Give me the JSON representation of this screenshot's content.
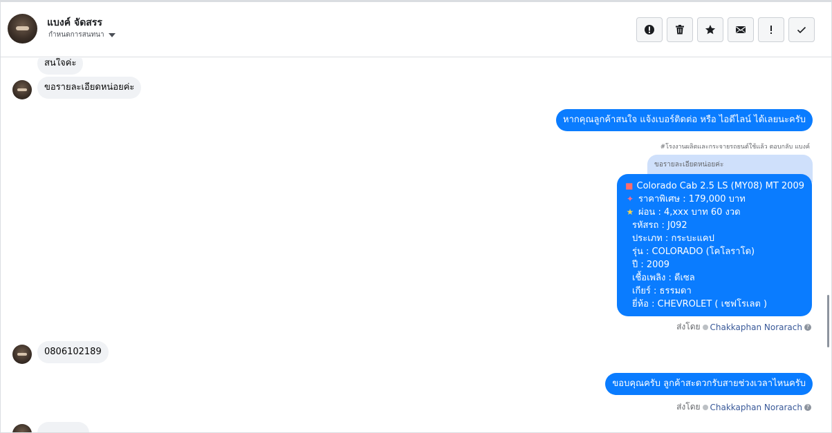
{
  "header": {
    "contact_name": "แบงค์ จัดสรร",
    "sub_label": "กำหนดการสนทนา"
  },
  "actions": [
    {
      "name": "report-button",
      "icon": "alert-circle-icon"
    },
    {
      "name": "delete-button",
      "icon": "trash-icon"
    },
    {
      "name": "star-button",
      "icon": "star-icon"
    },
    {
      "name": "mail-button",
      "icon": "mail-icon"
    },
    {
      "name": "important-button",
      "icon": "exclamation-icon"
    },
    {
      "name": "done-button",
      "icon": "check-icon"
    }
  ],
  "messages": {
    "in_1": "สนใจค่ะ",
    "in_2": "ขอรายละเอียดหน่อยค่ะ",
    "out_1": "หากคุณลูกค้าสนใจ แจ้งเบอร์ติดต่อ หรือ ไอดีไลน์ ได้เลยนะครับ",
    "reply_note": "#โรงงานผลิตและกระจายรถยนต์ใช้แล้ว ตอบกลับ แบงค์",
    "reply_quote": "ขอรายละเอียดหน่อยค่ะ",
    "card": {
      "line1": "Colorado Cab 2.5 LS (MY08) MT 2009",
      "line2": "ราคาพิเศษ : 179,000 บาท",
      "line3": "ผ่อน : 4,xxx บาท 60 งวด",
      "line4": "รหัสรถ : J092",
      "line5": "ประเภท : กระบะแคป",
      "line6": "รุ่น : COLORADO (โคโลราโด)",
      "line7": "ปี : 2009",
      "line8": "เชื้อเพลิง : ดีเซล",
      "line9": "เกียร์ : ธรรมดา",
      "line10": "ยี่ห้อ : CHEVROLET ( เชฟโรเลต )"
    },
    "sent_by_label": "ส่งโดย",
    "sent_by_name": "Chakkaphan Norarach",
    "in_3": "0806102189",
    "out_2": "ขอบคุณครับ ลูกค้าสะดวกรับสายช่วงเวลาไหนครับ"
  }
}
